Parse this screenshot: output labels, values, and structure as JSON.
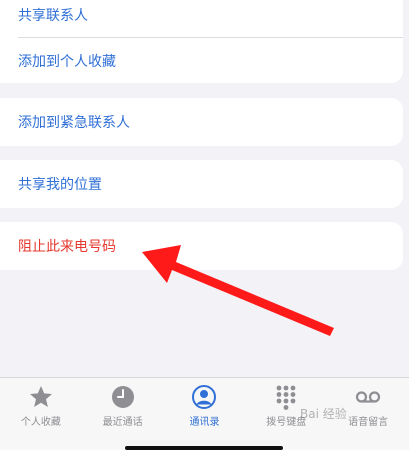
{
  "actions": {
    "share_contact": "共享联系人",
    "add_to_favorites": "添加到个人收藏",
    "add_to_emergency": "添加到紧急联系人",
    "share_location": "共享我的位置",
    "block_caller": "阻止此来电号码"
  },
  "tabbar": {
    "favorites": "个人收藏",
    "recents": "最近通话",
    "contacts": "通讯录",
    "keypad": "拨号键盘",
    "voicemail": "语音留言"
  },
  "watermark": "Bai 经验",
  "colors": {
    "accent": "#2f6fd6",
    "danger": "#e5382f",
    "inactive": "#8e8e93",
    "annotation_arrow": "#ff1a1a"
  }
}
